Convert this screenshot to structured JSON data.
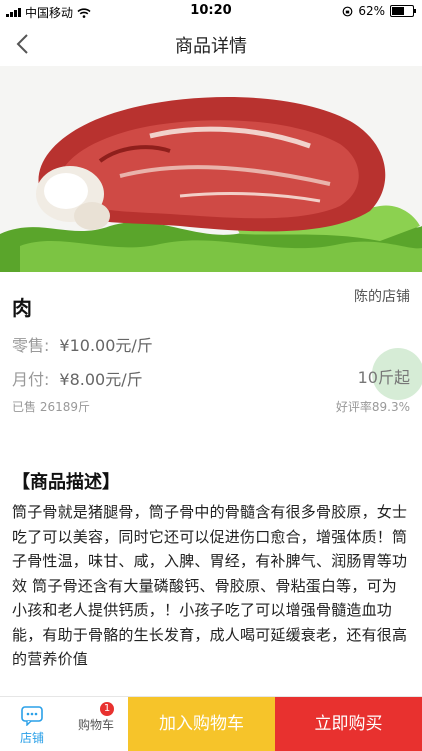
{
  "status_bar": {
    "carrier": "中国移动",
    "time": "10:20",
    "battery": "62%",
    "battery_level": 0.62
  },
  "nav": {
    "title": "商品详情"
  },
  "product": {
    "name": "肉",
    "shop": "陈的店铺",
    "retail_label": "零售:",
    "retail_price": "¥10.00元/斤",
    "monthly_label": "月付:",
    "monthly_price": "¥8.00元/斤",
    "min_qty": "10斤起",
    "sold": "已售 26189斤",
    "good_rate": "好评率89.3%"
  },
  "description": {
    "title": "【商品描述】",
    "body": "筒子骨就是猪腿骨，筒子骨中的骨髓含有很多骨胶原，女士吃了可以美容，同时它还可以促进伤口愈合，增强体质！筒子骨性温，味甘、咸，入脾、胃经，有补脾气、润肠胃等功效 筒子骨还含有大量磷酸钙、骨胶原、骨粘蛋白等，可为小孩和老人提供钙质，！小孩子吃了可以增强骨髓造血功能，有助于骨骼的生长发育，成人喝可延缓衰老，还有很高的营养价值"
  },
  "tabbar": {
    "store_label": "店铺",
    "cart_label": "购物车",
    "cart_badge": "1",
    "add_cart": "加入购物车",
    "buy_now": "立即购买"
  },
  "colors": {
    "accent_blue": "#2aa0e8",
    "buy_red": "#e8312f",
    "cart_yellow": "#f6c42a"
  }
}
